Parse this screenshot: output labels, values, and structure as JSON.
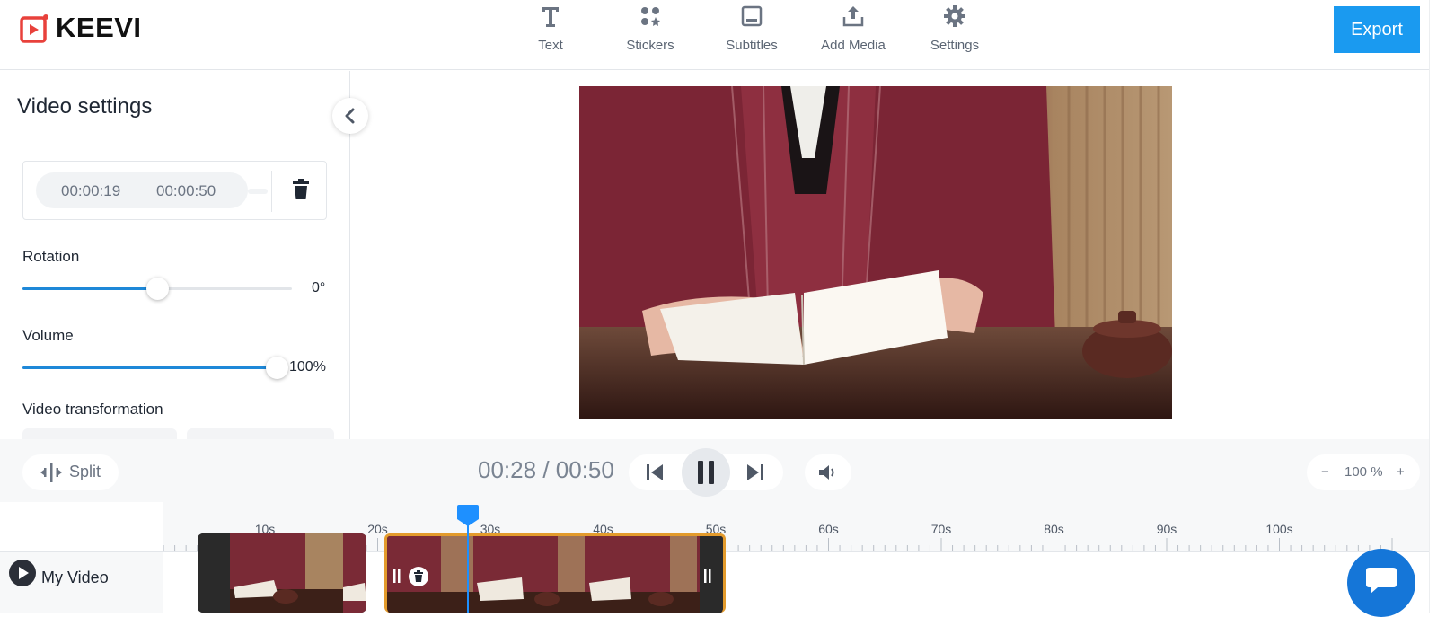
{
  "app": {
    "brand": "KEEVI"
  },
  "toolbar": {
    "items": [
      {
        "label": "Text",
        "icon": "text-icon"
      },
      {
        "label": "Stickers",
        "icon": "stickers-icon"
      },
      {
        "label": "Subtitles",
        "icon": "subtitles-icon"
      },
      {
        "label": "Add Media",
        "icon": "upload-icon"
      },
      {
        "label": "Settings",
        "icon": "gear-icon"
      }
    ],
    "export_label": "Export"
  },
  "panel": {
    "title": "Video settings",
    "trim": {
      "start": "00:00:19",
      "end": "00:00:50"
    },
    "rotation": {
      "label": "Rotation",
      "value": "0°",
      "level": 0.5
    },
    "volume": {
      "label": "Volume",
      "value": "100%",
      "level": 1.0
    },
    "transformation_label": "Video transformation"
  },
  "controls": {
    "split_label": "Split",
    "current_time": "00:28",
    "separator": "/",
    "total_time": "00:50",
    "zoom_minus": "−",
    "zoom_value": "100 %",
    "zoom_plus": "+"
  },
  "timeline": {
    "ticks": [
      "10s",
      "20s",
      "30s",
      "40s",
      "50s",
      "60s",
      "70s",
      "80s",
      "90s",
      "100s"
    ],
    "track_name": "My Video",
    "playhead_seconds": 28
  },
  "colors": {
    "accent": "#1a9af0",
    "slider": "#1e88d8",
    "clip_selected_border": "#e39b2c",
    "chat": "#1576d8"
  }
}
